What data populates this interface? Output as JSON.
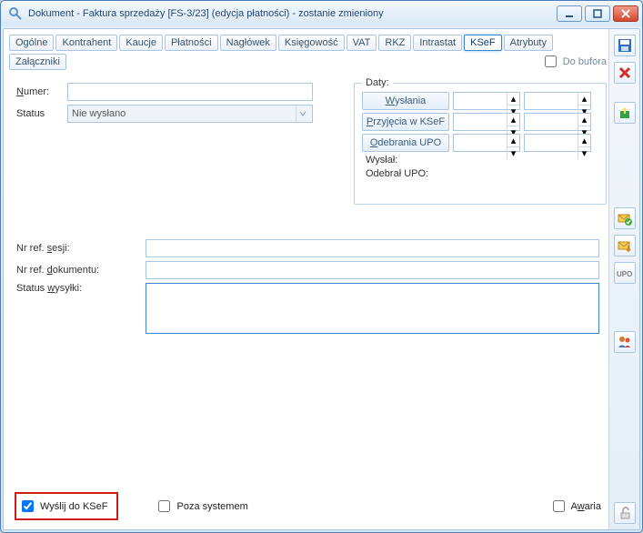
{
  "window": {
    "title": "Dokument - Faktura sprzedaży [FS-3/23] (edycja płatności) - zostanie zmieniony"
  },
  "tabs": {
    "items": [
      {
        "label": "Ogólne"
      },
      {
        "label": "Kontrahent"
      },
      {
        "label": "Kaucje"
      },
      {
        "label": "Płatności"
      },
      {
        "label": "Nagłówek"
      },
      {
        "label": "Księgowość"
      },
      {
        "label": "VAT"
      },
      {
        "label": "RKZ"
      },
      {
        "label": "Intrastat"
      },
      {
        "label": "KSeF"
      },
      {
        "label": "Atrybuty"
      },
      {
        "label": "Załączniki"
      }
    ],
    "active_index": 9,
    "do_bufora_label": "Do bufora"
  },
  "left_group": {
    "numer_label": "Numer:",
    "numer_value": "",
    "status_label": "Status",
    "status_value": "Nie wysłano"
  },
  "right_group": {
    "legend": "Daty:",
    "wyslania_label": "Wysłania",
    "wyslania_date": "",
    "wyslania_time": "",
    "przyjecia_label": "Przyjęcia w KSeF",
    "przyjecia_date": "",
    "przyjecia_time": "",
    "odebrania_label": "Odebrania UPO",
    "odebrania_date": "",
    "odebrania_time": "",
    "wyslal_label": "Wysłał:",
    "wyslal_value": "",
    "odebral_label": "Odebrał UPO:",
    "odebral_value": ""
  },
  "refs": {
    "sesji_label": "Nr ref. sesji:",
    "sesji_value": "",
    "dokumentu_label": "Nr ref. dokumentu:",
    "dokumentu_value": "",
    "wysylki_label": "Status wysyłki:",
    "wysylki_value": ""
  },
  "bottom": {
    "wyslij_label": "Wyślij do KSeF",
    "wyslij_checked": true,
    "poza_label": "Poza systemem",
    "poza_checked": false,
    "awaria_label": "Awaria",
    "awaria_checked": false
  }
}
